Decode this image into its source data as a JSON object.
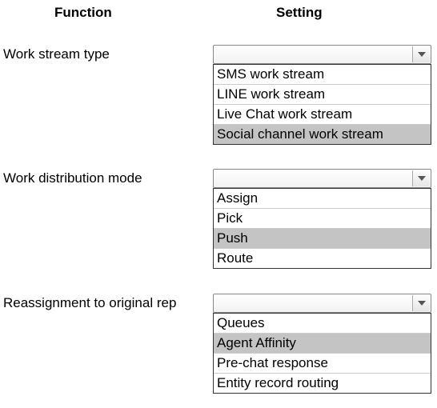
{
  "headers": {
    "function": "Function",
    "setting": "Setting"
  },
  "rows": [
    {
      "label": "Work stream type",
      "options": [
        {
          "text": "SMS work stream",
          "highlighted": false
        },
        {
          "text": "LINE work stream",
          "highlighted": false
        },
        {
          "text": "Live Chat work stream",
          "highlighted": false
        },
        {
          "text": "Social channel work stream",
          "highlighted": true
        }
      ]
    },
    {
      "label": "Work distribution mode",
      "options": [
        {
          "text": "Assign",
          "highlighted": false
        },
        {
          "text": "Pick",
          "highlighted": false
        },
        {
          "text": "Push",
          "highlighted": true
        },
        {
          "text": "Route",
          "highlighted": false
        }
      ]
    },
    {
      "label": "Reassignment to original rep",
      "options": [
        {
          "text": "Queues",
          "highlighted": false
        },
        {
          "text": "Agent Affinity",
          "highlighted": true
        },
        {
          "text": "Pre-chat response",
          "highlighted": false
        },
        {
          "text": "Entity record routing",
          "highlighted": false
        }
      ]
    }
  ]
}
